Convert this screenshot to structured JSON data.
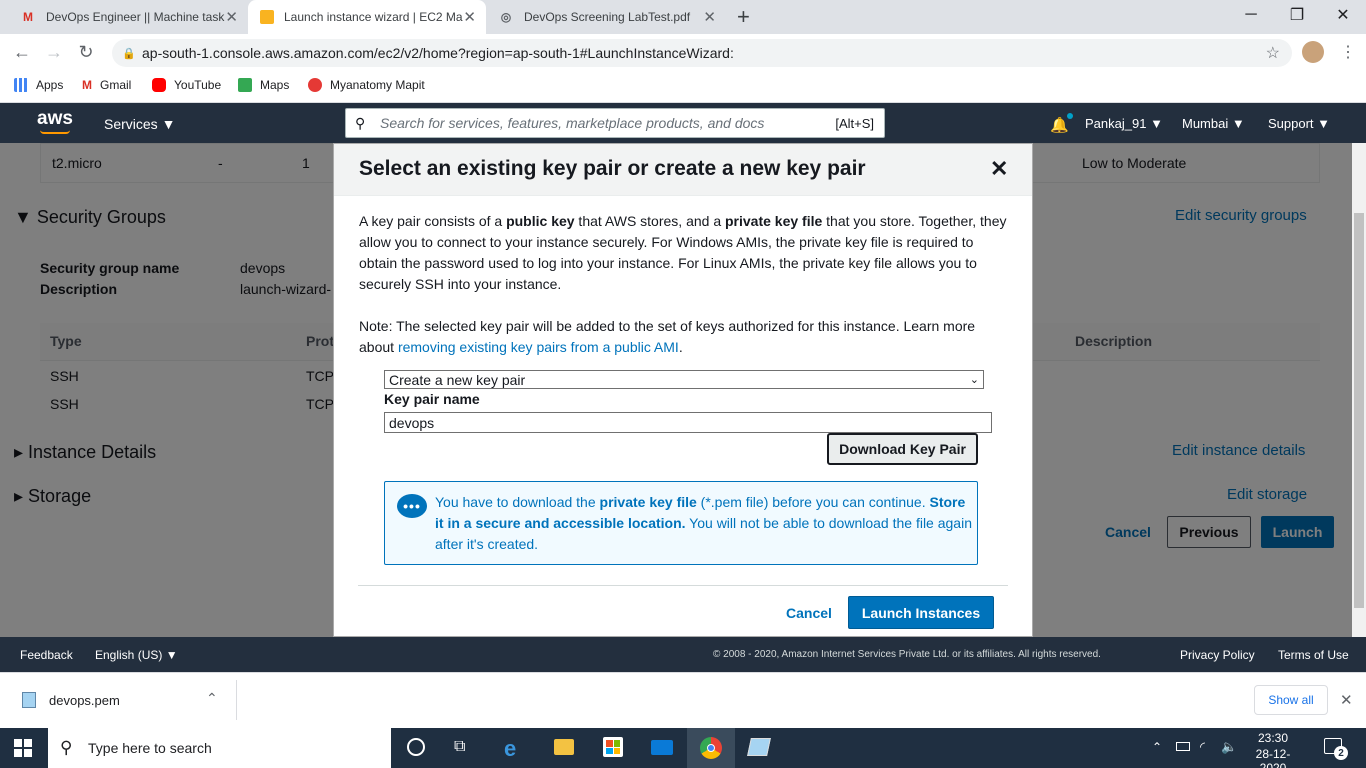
{
  "browser": {
    "tabs": [
      {
        "title": "DevOps Engineer || Machine task",
        "icon": "gmail-icon"
      },
      {
        "title": "Launch instance wizard | EC2 Ma",
        "icon": "aws-box-icon"
      },
      {
        "title": "DevOps Screening LabTest.pdf",
        "icon": "globe-icon"
      }
    ],
    "url": "ap-south-1.console.aws.amazon.com/ec2/v2/home?region=ap-south-1#LaunchInstanceWizard:",
    "bookmarks": [
      "Apps",
      "Gmail",
      "YouTube",
      "Maps",
      "Myanatomy Mapit"
    ]
  },
  "aws_nav": {
    "logo": "aws",
    "services": "Services",
    "search_placeholder": "Search for services, features, marketplace products, and docs",
    "search_shortcut": "[Alt+S]",
    "user": "Pankaj_91",
    "region": "Mumbai",
    "support": "Support"
  },
  "background": {
    "row_type": "t2.micro",
    "row_dash": "-",
    "row_one": "1",
    "row_perf": "Low to Moderate",
    "security_groups": "Security Groups",
    "edit_security_groups": "Edit security groups",
    "sg_name_label": "Security group name",
    "sg_name_value": "devops",
    "desc_label": "Description",
    "desc_value": "launch-wizard-",
    "col_type": "Type",
    "col_proto": "Prot",
    "col_desc": "Description",
    "rows": [
      {
        "type": "SSH",
        "proto": "TCP"
      },
      {
        "type": "SSH",
        "proto": "TCP"
      }
    ],
    "instance_details": "Instance Details",
    "edit_instance_details": "Edit instance details",
    "storage": "Storage",
    "edit_storage": "Edit storage",
    "cancel": "Cancel",
    "previous": "Previous",
    "launch": "Launch"
  },
  "modal": {
    "title": "Select an existing key pair or create a new key pair",
    "para1_a": "A key pair consists of a ",
    "para1_b": "public key",
    "para1_c": " that AWS stores, and a ",
    "para1_d": "private key file",
    "para1_e": " that you store. Together, they allow you to connect to your instance securely. For Windows AMIs, the private key file is required to obtain the password used to log into your instance. For Linux AMIs, the private key file allows you to securely SSH into your instance.",
    "note_a": "Note: The selected key pair will be added to the set of keys authorized for this instance. Learn more about ",
    "note_link": "removing existing key pairs from a public AMI",
    "note_b": ".",
    "select_value": "Create a new key pair",
    "kp_label": "Key pair name",
    "kp_value": "devops",
    "download": "Download Key Pair",
    "info_a": "You have to download the ",
    "info_b": "private key file",
    "info_c": " (*.pem file) before you can continue. ",
    "info_d": "Store it in a secure and accessible location.",
    "info_e": " You will not be able to download the file again after it's created.",
    "cancel": "Cancel",
    "launch": "Launch Instances"
  },
  "footer": {
    "feedback": "Feedback",
    "language": "English (US)",
    "copyright": "© 2008 - 2020, Amazon Internet Services Private Ltd. or its affiliates. All rights reserved.",
    "privacy": "Privacy Policy",
    "terms": "Terms of Use"
  },
  "shelf": {
    "file": "devops.pem",
    "show_all": "Show all"
  },
  "taskbar": {
    "search": "Type here to search",
    "time": "23:30",
    "date": "28-12-2020",
    "notifications": "2"
  }
}
